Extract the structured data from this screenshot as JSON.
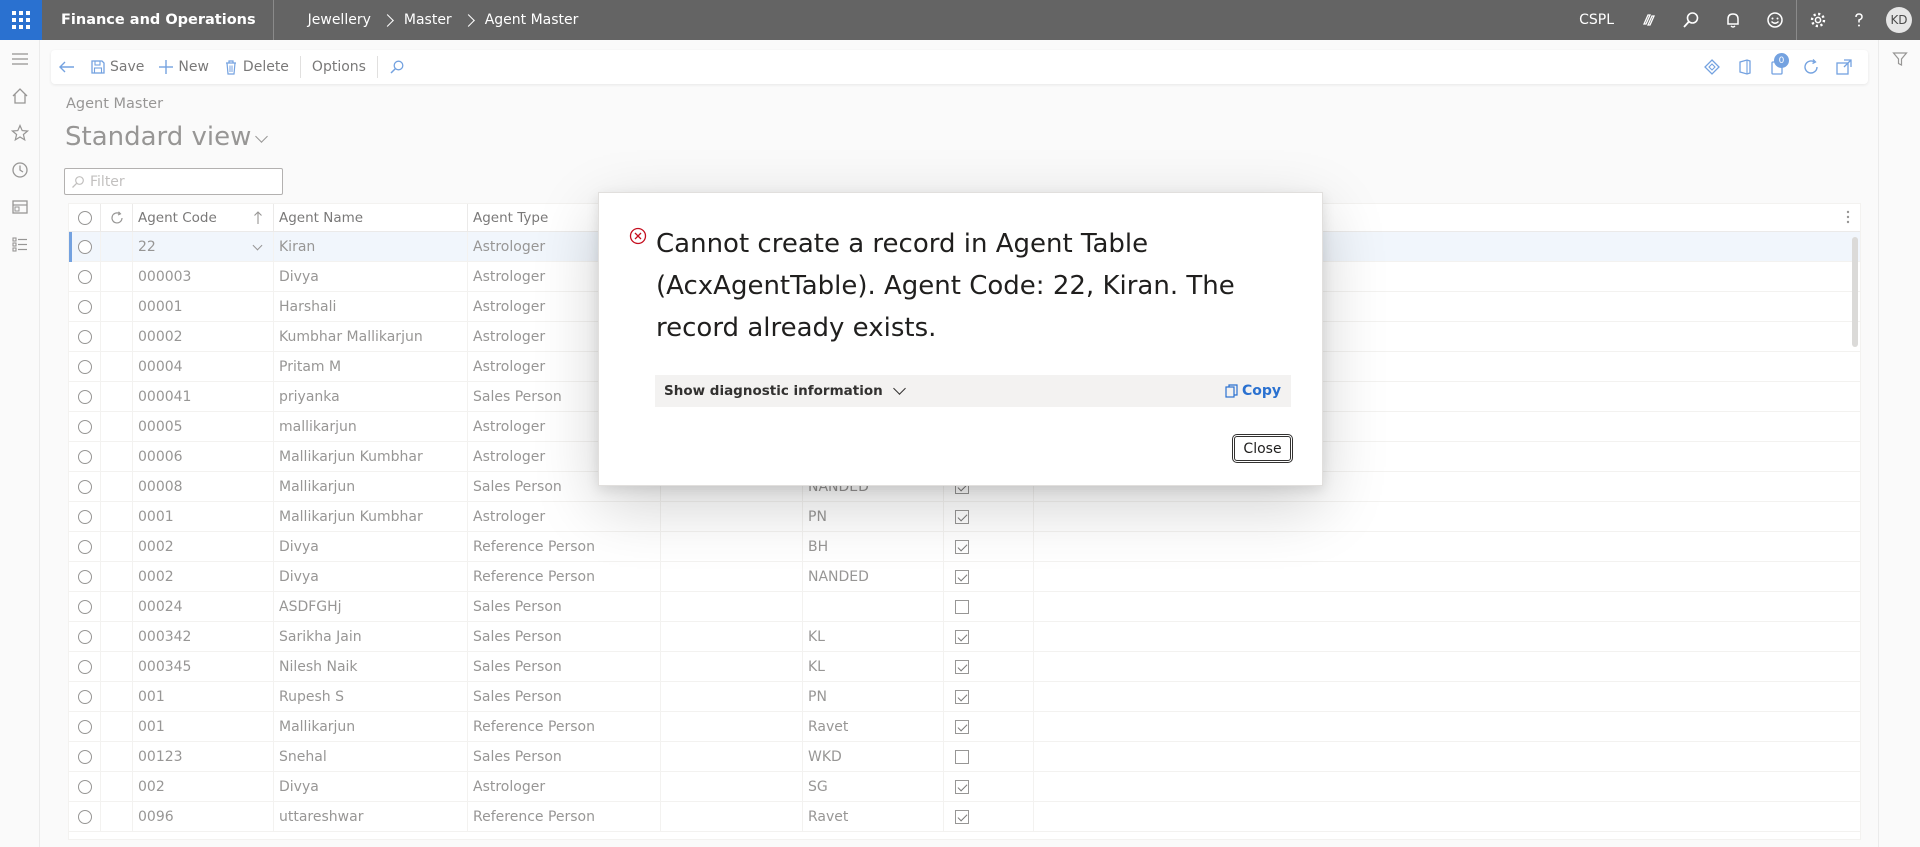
{
  "topbar": {
    "app_name": "Finance and Operations",
    "breadcrumbs": [
      "Jewellery",
      "Master",
      "Agent Master"
    ],
    "company": "CSPL",
    "user_initials": "KD"
  },
  "action_pane": {
    "save_label": "Save",
    "new_label": "New",
    "delete_label": "Delete",
    "options_label": "Options",
    "notification_count": "0"
  },
  "page": {
    "caption": "Agent Master",
    "view_name": "Standard view",
    "filter_placeholder": "Filter"
  },
  "grid": {
    "columns": [
      "Agent Code",
      "Agent Name",
      "Agent Type"
    ],
    "rows": [
      {
        "code": "22",
        "name": "Kiran",
        "type": "Astrologer",
        "e1": "",
        "e2": "",
        "checked": true
      },
      {
        "code": "000003",
        "name": "Divya",
        "type": "Astrologer",
        "e1": "",
        "e2": "",
        "checked": true
      },
      {
        "code": "00001",
        "name": "Harshali",
        "type": "Astrologer",
        "e1": "",
        "e2": "",
        "checked": true
      },
      {
        "code": "00002",
        "name": "Kumbhar Mallikarjun",
        "type": "Astrologer",
        "e1": "",
        "e2": "",
        "checked": true
      },
      {
        "code": "00004",
        "name": "Pritam M",
        "type": "Astrologer",
        "e1": "",
        "e2": "",
        "checked": true
      },
      {
        "code": "000041",
        "name": "priyanka",
        "type": "Sales Person",
        "e1": "",
        "e2": "",
        "checked": true
      },
      {
        "code": "00005",
        "name": "mallikarjun",
        "type": "Astrologer",
        "e1": "",
        "e2": "",
        "checked": true
      },
      {
        "code": "00006",
        "name": "Mallikarjun Kumbhar",
        "type": "Astrologer",
        "e1": "",
        "e2": "",
        "checked": true
      },
      {
        "code": "00008",
        "name": "Mallikarjun",
        "type": "Sales Person",
        "e1": "",
        "e2": "NANDED",
        "checked": true
      },
      {
        "code": "0001",
        "name": "Mallikarjun Kumbhar",
        "type": "Astrologer",
        "e1": "",
        "e2": "PN",
        "checked": true
      },
      {
        "code": "0002",
        "name": "Divya",
        "type": "Reference Person",
        "e1": "",
        "e2": "BH",
        "checked": true
      },
      {
        "code": "0002",
        "name": "Divya",
        "type": "Reference Person",
        "e1": "",
        "e2": "NANDED",
        "checked": true
      },
      {
        "code": "00024",
        "name": "ASDFGHj",
        "type": "Sales Person",
        "e1": "",
        "e2": "",
        "checked": false
      },
      {
        "code": "000342",
        "name": "Sarikha Jain",
        "type": "Sales Person",
        "e1": "",
        "e2": "KL",
        "checked": true
      },
      {
        "code": "000345",
        "name": "Nilesh Naik",
        "type": "Sales Person",
        "e1": "",
        "e2": "KL",
        "checked": true
      },
      {
        "code": "001",
        "name": "Rupesh S",
        "type": "Sales Person",
        "e1": "",
        "e2": "PN",
        "checked": true
      },
      {
        "code": "001",
        "name": "Mallikarjun",
        "type": "Reference Person",
        "e1": "",
        "e2": "Ravet",
        "checked": true
      },
      {
        "code": "00123",
        "name": "Snehal",
        "type": "Sales Person",
        "e1": "",
        "e2": "WKD",
        "checked": false
      },
      {
        "code": "002",
        "name": "Divya",
        "type": "Astrologer",
        "e1": "",
        "e2": "SG",
        "checked": true
      },
      {
        "code": "0096",
        "name": "uttareshwar",
        "type": "Reference Person",
        "e1": "",
        "e2": "Ravet",
        "checked": true
      }
    ]
  },
  "dialog": {
    "message": "Cannot create a record in Agent Table (AcxAgentTable). Agent Code: 22, Kiran. The record already exists.",
    "diagnostic_label": "Show diagnostic information",
    "copy_label": "Copy",
    "close_label": "Close"
  },
  "colors": {
    "accent": "#2a71d0",
    "topbar": "#646464",
    "error": "#c50f1f"
  }
}
